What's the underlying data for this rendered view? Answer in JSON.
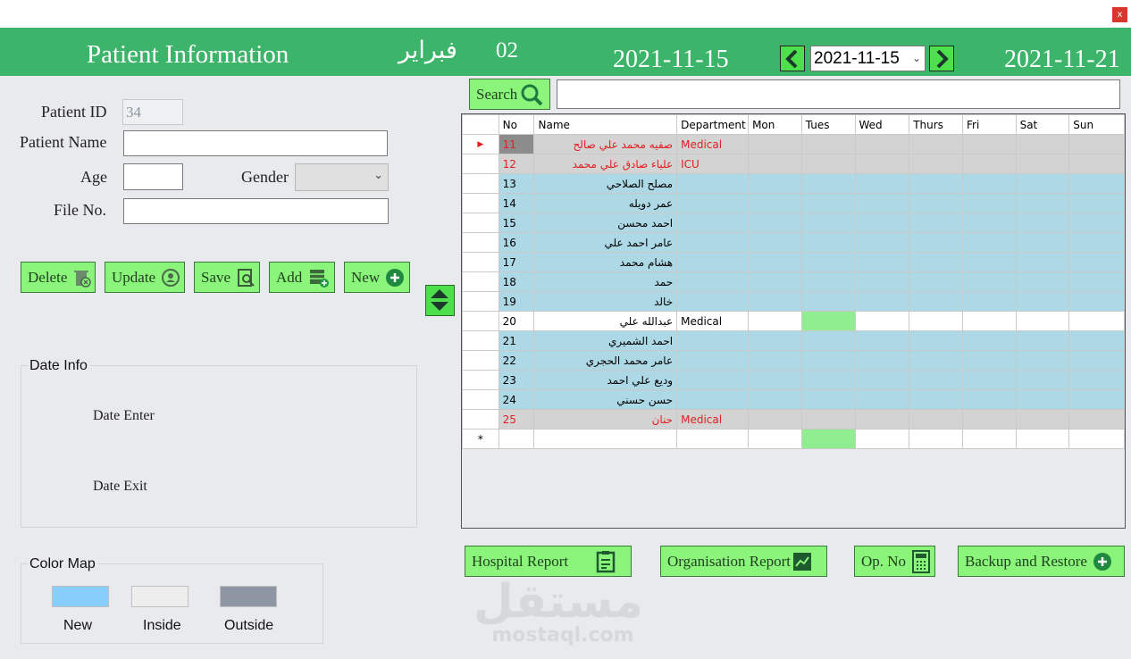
{
  "window": {
    "close_glyph": "x"
  },
  "header": {
    "title": "Patient Information",
    "month_name": "فبراير",
    "month_number": "02",
    "week_start": "2021-11-15",
    "picker_value": "2021-11-15",
    "week_end": "2021-11-21",
    "bg_color": "#3cb469"
  },
  "form": {
    "patient_id_label": "Patient ID",
    "patient_id_value": "34",
    "patient_name_label": "Patient Name",
    "age_label": "Age",
    "gender_label": "Gender",
    "file_no_label": "File No."
  },
  "actions": {
    "delete": "Delete",
    "update": "Update",
    "save": "Save",
    "add": "Add",
    "new": "New"
  },
  "date_info": {
    "title": "Date Info",
    "enter_label": "Date Enter",
    "exit_label": "Date Exit"
  },
  "color_map": {
    "title": "Color Map",
    "items": [
      {
        "label": "New",
        "color": "#87cefa"
      },
      {
        "label": "Inside",
        "color": "#eeeeee"
      },
      {
        "label": "Outside",
        "color": "#8e96a3"
      }
    ]
  },
  "search": {
    "button_label": "Search",
    "value": ""
  },
  "grid": {
    "columns": [
      "No",
      "Name",
      "Department",
      "Mon",
      "Tues",
      "Wed",
      "Thurs",
      "Fri",
      "Sat",
      "Sun"
    ],
    "rows": [
      {
        "no": "11",
        "name": "صفيه محمد علي صالح",
        "dept": "Medical",
        "status": "outside"
      },
      {
        "no": "12",
        "name": "علياء صادق علي محمد",
        "dept": "ICU",
        "status": "outside"
      },
      {
        "no": "13",
        "name": "مصلح الصلاحي",
        "dept": "",
        "status": "new"
      },
      {
        "no": "14",
        "name": "عمر دويله",
        "dept": "",
        "status": "new"
      },
      {
        "no": "15",
        "name": "احمد محسن",
        "dept": "",
        "status": "new"
      },
      {
        "no": "16",
        "name": "عامر احمد علي",
        "dept": "",
        "status": "new"
      },
      {
        "no": "17",
        "name": "هشام محمد",
        "dept": "",
        "status": "new"
      },
      {
        "no": "18",
        "name": "حمد",
        "dept": "",
        "status": "new"
      },
      {
        "no": "19",
        "name": "خالد",
        "dept": "",
        "status": "new"
      },
      {
        "no": "20",
        "name": "عبدالله علي",
        "dept": "Medical",
        "status": "inside"
      },
      {
        "no": "21",
        "name": "احمد الشميري",
        "dept": "",
        "status": "new"
      },
      {
        "no": "22",
        "name": "عامر محمد الحجري",
        "dept": "",
        "status": "new"
      },
      {
        "no": "23",
        "name": "وديع علي احمد",
        "dept": "",
        "status": "new"
      },
      {
        "no": "24",
        "name": "حسن حسني",
        "dept": "",
        "status": "new"
      },
      {
        "no": "25",
        "name": "حنان",
        "dept": "Medical",
        "status": "outside"
      }
    ],
    "new_row_marker": "*",
    "current_row_marker": "▶"
  },
  "reports": {
    "hospital": "Hospital Report",
    "organisation": "Organisation Report",
    "op_no": "Op. No",
    "backup": "Backup and Restore"
  },
  "watermark": {
    "arabic": "مستقل",
    "latin": "mostaql.com"
  }
}
